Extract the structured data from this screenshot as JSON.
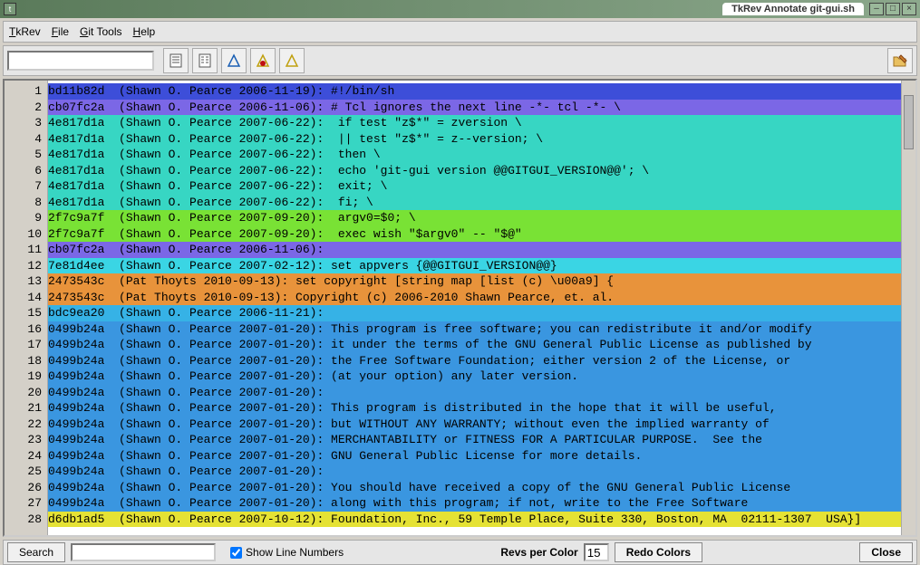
{
  "window": {
    "title": "TkRev Annotate git-gui.sh"
  },
  "menu": {
    "tkrev": "TkRev",
    "file": "File",
    "git_tools": "Git Tools",
    "help": "Help"
  },
  "toolbar": {
    "search_value": ""
  },
  "status": {
    "search_label": "Search",
    "search_value": "",
    "show_line_numbers_label": "Show Line Numbers",
    "show_line_numbers_checked": true,
    "revs_per_color_label": "Revs per Color",
    "revs_per_color_value": "15",
    "redo_colors_label": "Redo Colors",
    "close_label": "Close"
  },
  "colors": {
    "c_blue": "#3d4ed9",
    "c_purple": "#7b67e6",
    "c_teal": "#37d6c3",
    "c_lime": "#79e235",
    "c_skyblue": "#36b2e6",
    "c_cyan": "#3ad5e4",
    "c_orange": "#e8933b",
    "c_lightblue": "#3a96e0",
    "c_yellow": "#e5e234"
  },
  "lines": [
    {
      "n": 1,
      "color": "c_blue",
      "hash": "bd11b82d",
      "meta": "(Shawn O. Pearce 2006-11-19):",
      "text": " #!/bin/sh"
    },
    {
      "n": 2,
      "color": "c_purple",
      "hash": "cb07fc2a",
      "meta": "(Shawn O. Pearce 2006-11-06):",
      "text": " # Tcl ignores the next line -*- tcl -*- \\"
    },
    {
      "n": 3,
      "color": "c_teal",
      "hash": "4e817d1a",
      "meta": "(Shawn O. Pearce 2007-06-22):",
      "text": "  if test \"z$*\" = zversion \\"
    },
    {
      "n": 4,
      "color": "c_teal",
      "hash": "4e817d1a",
      "meta": "(Shawn O. Pearce 2007-06-22):",
      "text": "  || test \"z$*\" = z--version; \\"
    },
    {
      "n": 5,
      "color": "c_teal",
      "hash": "4e817d1a",
      "meta": "(Shawn O. Pearce 2007-06-22):",
      "text": "  then \\"
    },
    {
      "n": 6,
      "color": "c_teal",
      "hash": "4e817d1a",
      "meta": "(Shawn O. Pearce 2007-06-22):",
      "text": "  echo 'git-gui version @@GITGUI_VERSION@@'; \\"
    },
    {
      "n": 7,
      "color": "c_teal",
      "hash": "4e817d1a",
      "meta": "(Shawn O. Pearce 2007-06-22):",
      "text": "  exit; \\"
    },
    {
      "n": 8,
      "color": "c_teal",
      "hash": "4e817d1a",
      "meta": "(Shawn O. Pearce 2007-06-22):",
      "text": "  fi; \\"
    },
    {
      "n": 9,
      "color": "c_lime",
      "hash": "2f7c9a7f",
      "meta": "(Shawn O. Pearce 2007-09-20):",
      "text": "  argv0=$0; \\"
    },
    {
      "n": 10,
      "color": "c_lime",
      "hash": "2f7c9a7f",
      "meta": "(Shawn O. Pearce 2007-09-20):",
      "text": "  exec wish \"$argv0\" -- \"$@\""
    },
    {
      "n": 11,
      "color": "c_purple",
      "hash": "cb07fc2a",
      "meta": "(Shawn O. Pearce 2006-11-06):",
      "text": ""
    },
    {
      "n": 12,
      "color": "c_cyan",
      "hash": "7e81d4ee",
      "meta": "(Shawn O. Pearce 2007-02-12):",
      "text": " set appvers {@@GITGUI_VERSION@@}"
    },
    {
      "n": 13,
      "color": "c_orange",
      "hash": "2473543c",
      "meta": "(Pat Thoyts 2010-09-13):",
      "text": " set copyright [string map [list (c) \\u00a9] {"
    },
    {
      "n": 14,
      "color": "c_orange",
      "hash": "2473543c",
      "meta": "(Pat Thoyts 2010-09-13):",
      "text": " Copyright (c) 2006-2010 Shawn Pearce, et. al."
    },
    {
      "n": 15,
      "color": "c_skyblue",
      "hash": "bdc9ea20",
      "meta": "(Shawn O. Pearce 2006-11-21):",
      "text": ""
    },
    {
      "n": 16,
      "color": "c_lightblue",
      "hash": "0499b24a",
      "meta": "(Shawn O. Pearce 2007-01-20):",
      "text": " This program is free software; you can redistribute it and/or modify"
    },
    {
      "n": 17,
      "color": "c_lightblue",
      "hash": "0499b24a",
      "meta": "(Shawn O. Pearce 2007-01-20):",
      "text": " it under the terms of the GNU General Public License as published by"
    },
    {
      "n": 18,
      "color": "c_lightblue",
      "hash": "0499b24a",
      "meta": "(Shawn O. Pearce 2007-01-20):",
      "text": " the Free Software Foundation; either version 2 of the License, or"
    },
    {
      "n": 19,
      "color": "c_lightblue",
      "hash": "0499b24a",
      "meta": "(Shawn O. Pearce 2007-01-20):",
      "text": " (at your option) any later version."
    },
    {
      "n": 20,
      "color": "c_lightblue",
      "hash": "0499b24a",
      "meta": "(Shawn O. Pearce 2007-01-20):",
      "text": ""
    },
    {
      "n": 21,
      "color": "c_lightblue",
      "hash": "0499b24a",
      "meta": "(Shawn O. Pearce 2007-01-20):",
      "text": " This program is distributed in the hope that it will be useful,"
    },
    {
      "n": 22,
      "color": "c_lightblue",
      "hash": "0499b24a",
      "meta": "(Shawn O. Pearce 2007-01-20):",
      "text": " but WITHOUT ANY WARRANTY; without even the implied warranty of"
    },
    {
      "n": 23,
      "color": "c_lightblue",
      "hash": "0499b24a",
      "meta": "(Shawn O. Pearce 2007-01-20):",
      "text": " MERCHANTABILITY or FITNESS FOR A PARTICULAR PURPOSE.  See the"
    },
    {
      "n": 24,
      "color": "c_lightblue",
      "hash": "0499b24a",
      "meta": "(Shawn O. Pearce 2007-01-20):",
      "text": " GNU General Public License for more details."
    },
    {
      "n": 25,
      "color": "c_lightblue",
      "hash": "0499b24a",
      "meta": "(Shawn O. Pearce 2007-01-20):",
      "text": ""
    },
    {
      "n": 26,
      "color": "c_lightblue",
      "hash": "0499b24a",
      "meta": "(Shawn O. Pearce 2007-01-20):",
      "text": " You should have received a copy of the GNU General Public License"
    },
    {
      "n": 27,
      "color": "c_lightblue",
      "hash": "0499b24a",
      "meta": "(Shawn O. Pearce 2007-01-20):",
      "text": " along with this program; if not, write to the Free Software"
    },
    {
      "n": 28,
      "color": "c_yellow",
      "hash": "d6db1ad5",
      "meta": "(Shawn O. Pearce 2007-10-12):",
      "text": " Foundation, Inc., 59 Temple Place, Suite 330, Boston, MA  02111-1307  USA}]"
    }
  ]
}
